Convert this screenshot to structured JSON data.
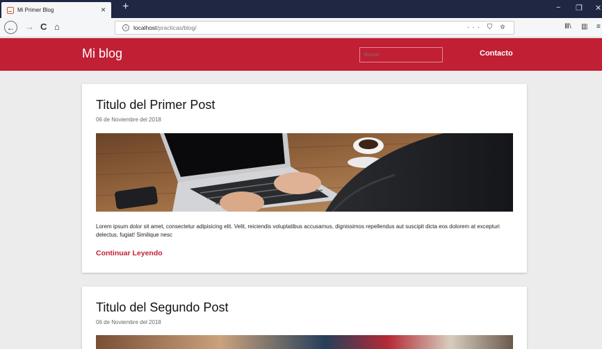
{
  "browser": {
    "tab_title": "Mi Primer Blog",
    "tab_close": "×",
    "new_tab": "+",
    "url_host": "localhost",
    "url_path": "/practicas/blog/",
    "url_actions": "··· ⛉ ☆",
    "minimize": "−",
    "restore": "❐",
    "close": "✕",
    "back": "←",
    "forward": "→",
    "reload": "C",
    "home": "⌂",
    "library": "Ⅲ\\",
    "sidebar": "▥",
    "menu": "≡"
  },
  "site": {
    "brand": "Mi blog",
    "search_placeholder": "Buscar",
    "contact": "Contacto"
  },
  "posts": [
    {
      "title": "Titulo del Primer Post",
      "date": "06 de Noviembre del 2018",
      "excerpt": "Lorem ipsum dolor sit amet, consectetur adipisicing elit. Velit, reiciendis voluptatibus accusamus, dignissimos repellendus aut suscipit dicta eos dolorem at excepturi delectus, fugiat! Similique nesc",
      "link": "Continuar Leyendo"
    },
    {
      "title": "Titulo del Segundo Post",
      "date": "06 de Noviembre del 2018"
    }
  ],
  "colors": {
    "brand_red": "#c01f34",
    "tabbar": "#1f2742",
    "page_bg": "#ececec"
  }
}
